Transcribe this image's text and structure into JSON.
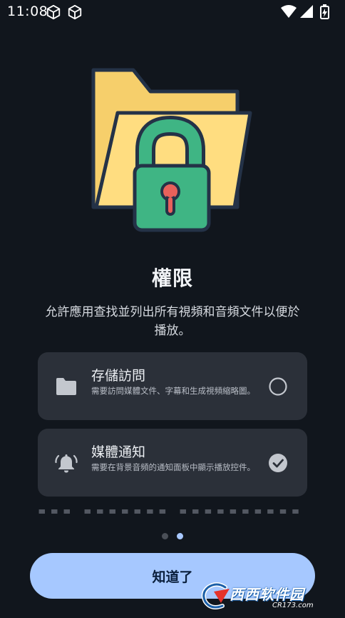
{
  "status_bar": {
    "time": "11:08",
    "icons": [
      "cube-icon",
      "cube-icon",
      "wifi-icon",
      "signal-icon",
      "battery-charging-icon"
    ]
  },
  "illustration": {
    "icon": "folder-lock-icon",
    "colors": {
      "folder_back": "#f6cf6b",
      "folder_front": "#ffdd80",
      "outline": "#243247",
      "lock_body": "#3fb584",
      "keyhole": "#e8615b"
    }
  },
  "title": "權限",
  "subtitle": "允許應用查找並列出所有視頻和音頻文件以便於播放。",
  "permissions": [
    {
      "icon": "folder-icon",
      "title": "存儲訪問",
      "description": "需要訪問媒體文件、字幕和生成視頻縮略圖。",
      "status": "unchecked"
    },
    {
      "icon": "bell-ringing-icon",
      "title": "媒體通知",
      "description": "需要在背景音頻的通知面板中顯示播放控件。",
      "status": "checked"
    }
  ],
  "pager": {
    "total": 2,
    "active": 2
  },
  "ok_button": {
    "label": "知道了"
  },
  "watermark": {
    "text": "西西软件园",
    "url": "CR173.com"
  },
  "colors": {
    "background": "#11161d",
    "card": "#2b3039",
    "accent": "#a6c8ff"
  }
}
